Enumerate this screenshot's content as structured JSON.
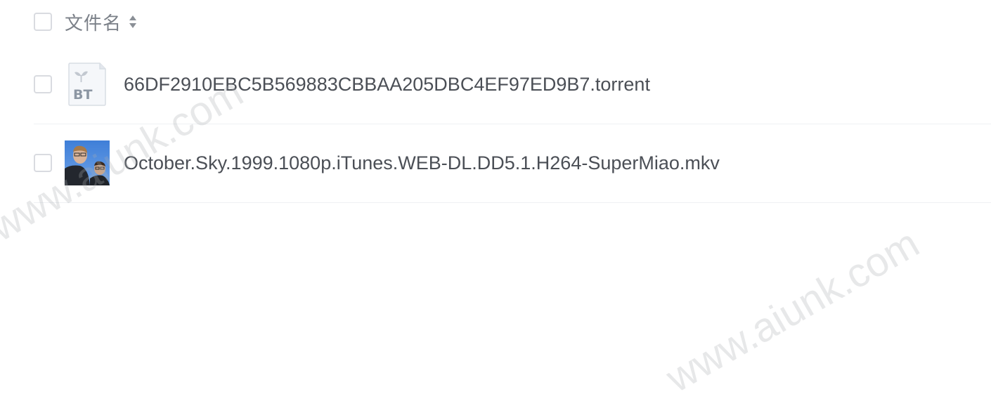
{
  "header": {
    "title": "文件名",
    "sort_icon": "sort-icon"
  },
  "files": [
    {
      "name": "66DF2910EBC5B569883CBBAA205DBC4EF97ED9B7.torrent",
      "icon": "bt-file-icon",
      "icon_label": "BT"
    },
    {
      "name": "October.Sky.1999.1080p.iTunes.WEB-DL.DD5.1.H264-SuperMiao.mkv",
      "icon": "video-thumbnail"
    }
  ],
  "watermark": "www.aiunk.com"
}
